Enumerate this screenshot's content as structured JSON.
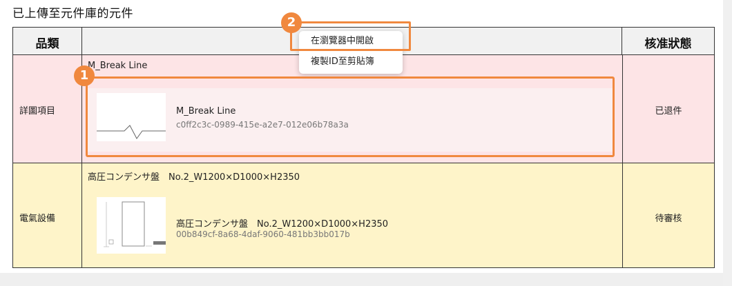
{
  "section_title": "已上傳至元件庫的元件",
  "table": {
    "headers": {
      "category": "品類",
      "status": "核准狀態"
    },
    "rows": [
      {
        "category": "詳圖項目",
        "name": "M_Break Line",
        "card_name": "M_Break Line",
        "card_id": "c0ff2c3c-0989-415e-a2e7-012e06b78a3a",
        "status": "已退件"
      },
      {
        "category": "電氣設備",
        "name": "高圧コンデンサ盤　No.2_W1200×D1000×H2350",
        "card_name": "高圧コンデンサ盤　No.2_W1200×D1000×H2350",
        "card_id": "00b849cf-8a68-4daf-9060-481bb3bb017b",
        "status": "待審核"
      }
    ]
  },
  "context_menu": {
    "items": [
      "在瀏覽器中開啟",
      "複製ID至剪貼簿"
    ]
  },
  "badges": [
    "1",
    "2"
  ],
  "colors": {
    "row1_bg": "#fde4e6",
    "row2_bg": "#fef4c9",
    "highlight": "#f0883e"
  }
}
